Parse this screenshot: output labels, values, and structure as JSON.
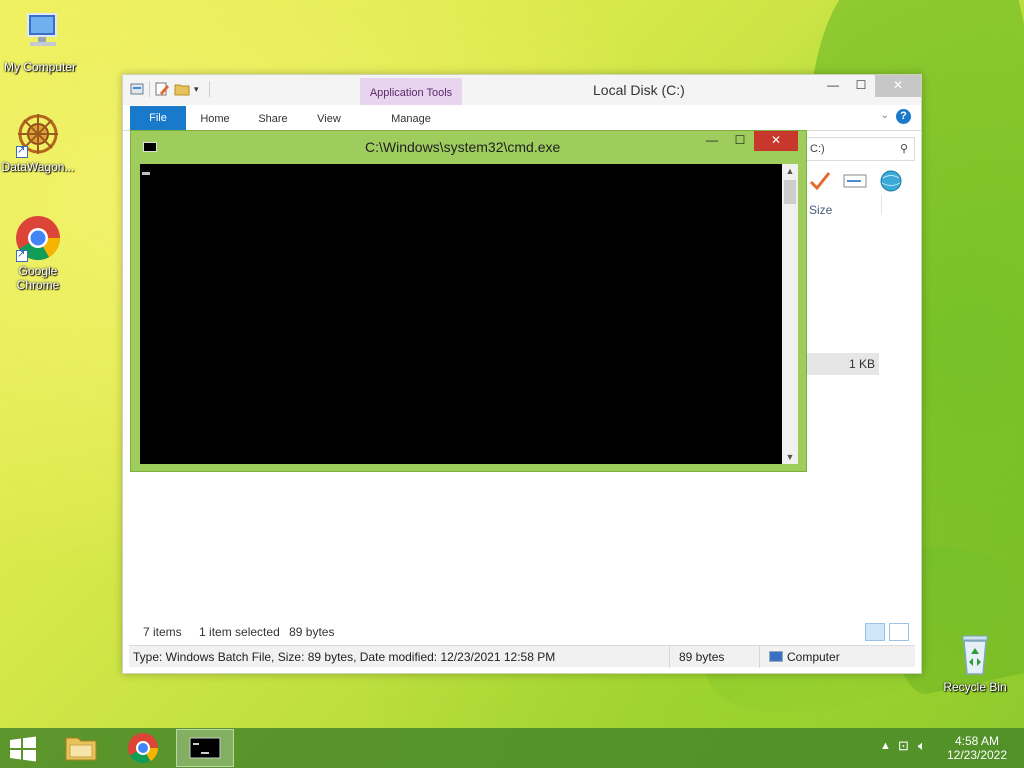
{
  "desktop": {
    "icons": [
      {
        "label": "My Computer"
      },
      {
        "label": "DataWagon..."
      },
      {
        "label": "Google Chrome"
      },
      {
        "label": "Recycle Bin"
      }
    ]
  },
  "explorer": {
    "title": "Local Disk (C:)",
    "app_tools_label": "Application Tools",
    "tabs": [
      "File",
      "Home",
      "Share",
      "View",
      "Manage"
    ],
    "search_text": "C:)",
    "column_size": "Size",
    "size_value": "1 KB",
    "status": {
      "items": "7 items",
      "selected": "1 item selected",
      "size": "89 bytes"
    },
    "details": {
      "type_text": "Type: Windows Batch File, Size: 89 bytes, Date modified: 12/23/2021 12:58 PM",
      "size": "89 bytes",
      "location": "Computer"
    }
  },
  "cmd": {
    "title": "C:\\Windows\\system32\\cmd.exe"
  },
  "taskbar": {
    "time": "4:58 AM",
    "date": "12/23/2022"
  },
  "colors": {
    "file_tab": "#1979ca",
    "app_tools": "#e9d4ef",
    "cmd_frame": "#9fcd5d",
    "close_red": "#c7372b"
  }
}
